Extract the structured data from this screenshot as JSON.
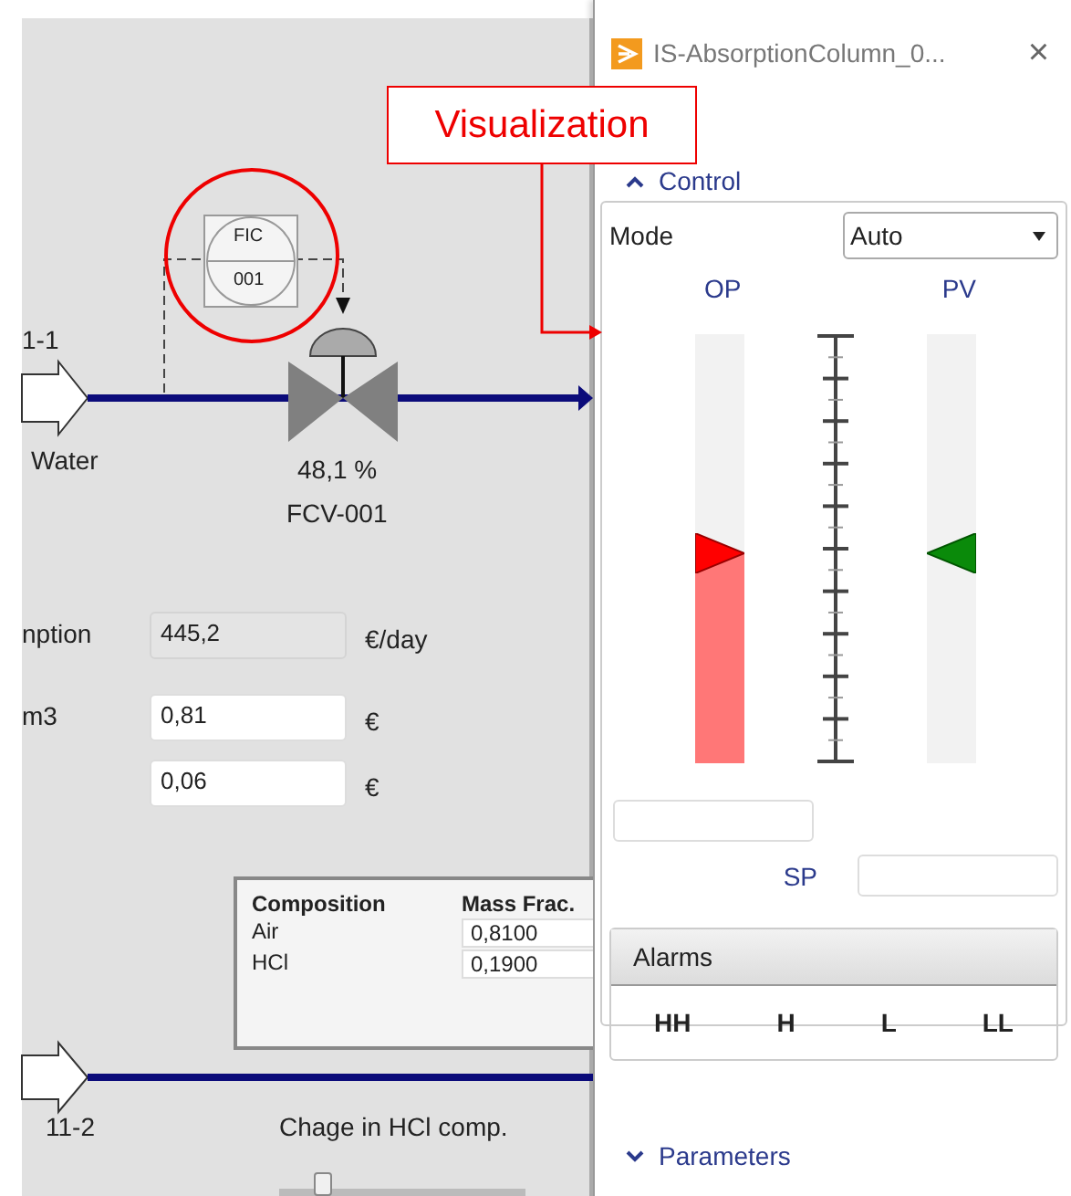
{
  "diagram": {
    "inlet_top": {
      "tag": "1-1",
      "name": "Water"
    },
    "controller": {
      "tag": "FIC",
      "number": "001"
    },
    "valve": {
      "opening": "48,1 %",
      "tag": "FCV-001"
    },
    "cost_fields": [
      {
        "label": "nption",
        "value": "445,2",
        "unit": "€/day",
        "disabled": true
      },
      {
        "label": "m3",
        "value": "0,81",
        "unit": "€",
        "disabled": false
      },
      {
        "value": "0,06",
        "unit": "€",
        "disabled": false
      }
    ],
    "composition": {
      "columns": [
        "Composition",
        "Mass Frac."
      ],
      "rows": [
        {
          "component": "Air",
          "value": "0,8100"
        },
        {
          "component": "HCl",
          "value": "0,1900"
        }
      ]
    },
    "inlet_bottom": {
      "tag": "11-2"
    },
    "slider": {
      "label": "Chage in HCl comp.",
      "level": 0.18
    }
  },
  "callout": {
    "text": "Visualization"
  },
  "panel": {
    "title": "IS-AbsorptionColumn_0...",
    "close": "×",
    "control": {
      "title": "Control",
      "expanded": true,
      "mode_label": "Mode",
      "mode": "Auto",
      "op": {
        "label": "OP",
        "level": 0.49
      },
      "pv": {
        "label": "PV",
        "level": 0.49
      },
      "sp_label": "SP",
      "alarms": {
        "title": "Alarms",
        "levels": [
          "HH",
          "H",
          "L",
          "LL"
        ]
      }
    },
    "parameters": {
      "title": "Parameters",
      "expanded": false
    }
  }
}
